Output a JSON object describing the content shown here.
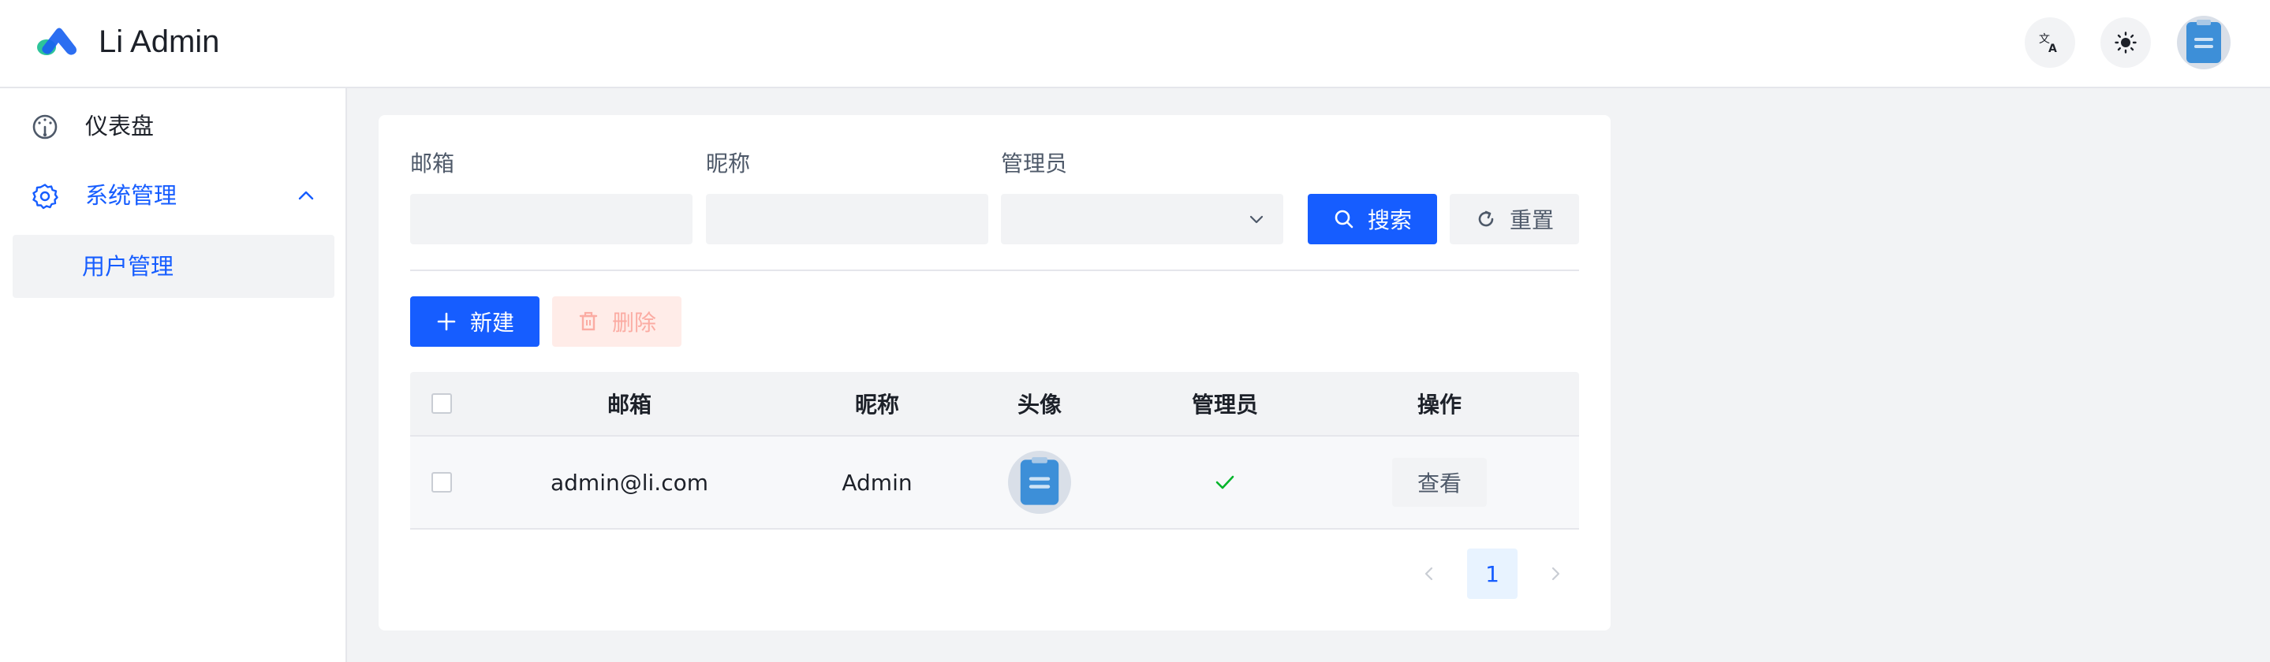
{
  "app": {
    "title": "Li Admin"
  },
  "header": {
    "language_icon": "translate-icon",
    "theme_icon": "sun-icon",
    "avatar_icon": "clipboard-avatar-icon"
  },
  "sidebar": {
    "items": [
      {
        "label": "仪表盘",
        "icon": "dashboard-gauge-icon"
      },
      {
        "label": "系统管理",
        "icon": "gear-icon",
        "expanded": true,
        "children": [
          {
            "label": "用户管理",
            "active": true
          }
        ]
      }
    ]
  },
  "filters": {
    "email_label": "邮箱",
    "email_value": "",
    "nickname_label": "昵称",
    "nickname_value": "",
    "admin_label": "管理员",
    "admin_value": "",
    "search_label": "搜索",
    "reset_label": "重置"
  },
  "toolbar": {
    "new_label": "新建",
    "delete_label": "删除"
  },
  "table": {
    "columns": [
      "邮箱",
      "昵称",
      "头像",
      "管理员",
      "操作"
    ],
    "rows": [
      {
        "email": "admin@li.com",
        "nickname": "Admin",
        "avatar": "clipboard-avatar-icon",
        "admin": true,
        "action_label": "查看"
      }
    ]
  },
  "pagination": {
    "current_page": "1"
  },
  "colors": {
    "primary": "#165dff",
    "background": "#f2f3f5",
    "success": "#00b42a",
    "danger_light": "#ffece8"
  }
}
